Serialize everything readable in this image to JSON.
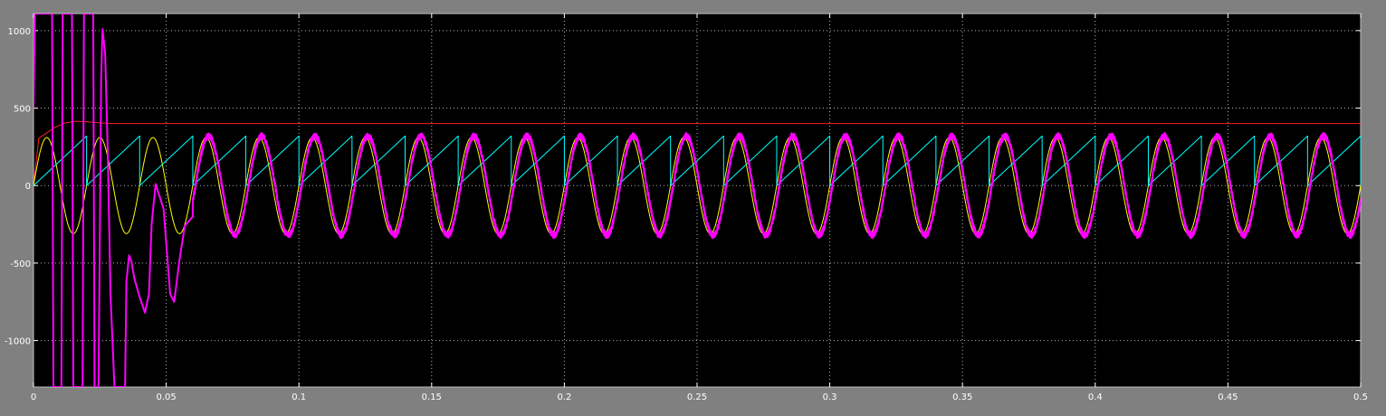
{
  "chart_data": {
    "type": "line",
    "title": "",
    "xlabel": "",
    "ylabel": "",
    "xlim": [
      0,
      0.5
    ],
    "ylim": [
      -1300,
      1110
    ],
    "grid": true,
    "background": "#000000",
    "frame_color": "#808080",
    "x_ticks": [
      0,
      0.05,
      0.1,
      0.15,
      0.2,
      0.25,
      0.3,
      0.35,
      0.4,
      0.45,
      0.5
    ],
    "x_tick_labels": [
      "0",
      "0.05",
      "0.1",
      "0.15",
      "0.2",
      "0.25",
      "0.3",
      "0.35",
      "0.4",
      "0.45",
      "0.5"
    ],
    "y_ticks": [
      1000,
      500,
      0,
      -500,
      -1000
    ],
    "y_tick_labels": [
      "1000",
      "500",
      "0",
      "-500",
      "-1000"
    ],
    "series": [
      {
        "color": "#ff2020",
        "description": "DC level",
        "x": [
          0,
          0.002,
          0.005,
          0.008,
          0.012,
          0.016,
          0.02,
          0.025,
          0.03,
          0.035,
          0.5
        ],
        "y": [
          0,
          305,
          340,
          375,
          405,
          415,
          412,
          405,
          400,
          400,
          400
        ]
      },
      {
        "color": "#ffff00",
        "description": "sine reference",
        "model": {
          "kind": "sine",
          "amplitude": 310,
          "frequency_hz": 50,
          "x_range": [
            0,
            0.5
          ]
        }
      },
      {
        "color": "#00ffff",
        "description": "sawtooth carrier",
        "model": {
          "kind": "sawtooth",
          "min": 0,
          "max": 320,
          "period_s": 0.02,
          "x_range": [
            0,
            0.5
          ]
        }
      },
      {
        "color": "#ff00ff",
        "description": "output",
        "transient": {
          "x": [
            0,
            0.0005,
            0.004,
            0.007,
            0.0075,
            0.009,
            0.0105,
            0.011,
            0.013,
            0.0145,
            0.015,
            0.017,
            0.0185,
            0.019,
            0.021,
            0.0225,
            0.023,
            0.0245,
            0.0255,
            0.026,
            0.027,
            0.028,
            0.029,
            0.0305,
            0.032,
            0.0345,
            0.035,
            0.036,
            0.0365,
            0.037,
            0.038,
            0.04,
            0.042,
            0.0435,
            0.0445,
            0.046,
            0.049,
            0.0515,
            0.053,
            0.055,
            0.057,
            0.06
          ],
          "y": [
            500,
            1110,
            1110,
            1110,
            -1300,
            -1300,
            -1300,
            1110,
            1110,
            1110,
            -1300,
            -1300,
            -1300,
            1110,
            1110,
            1110,
            -1300,
            -1300,
            700,
            1010,
            850,
            200,
            -700,
            -1300,
            -1300,
            -1300,
            -620,
            -450,
            -470,
            -500,
            -600,
            -720,
            -820,
            -700,
            -250,
            10,
            -150,
            -700,
            -750,
            -480,
            -260,
            -200
          ]
        },
        "steady_state": {
          "kind": "sine",
          "amplitude": 320,
          "frequency_hz": 50,
          "phase_shift_s": 0.001,
          "noise": 20,
          "x_range": [
            0.06,
            0.5
          ]
        }
      }
    ]
  }
}
